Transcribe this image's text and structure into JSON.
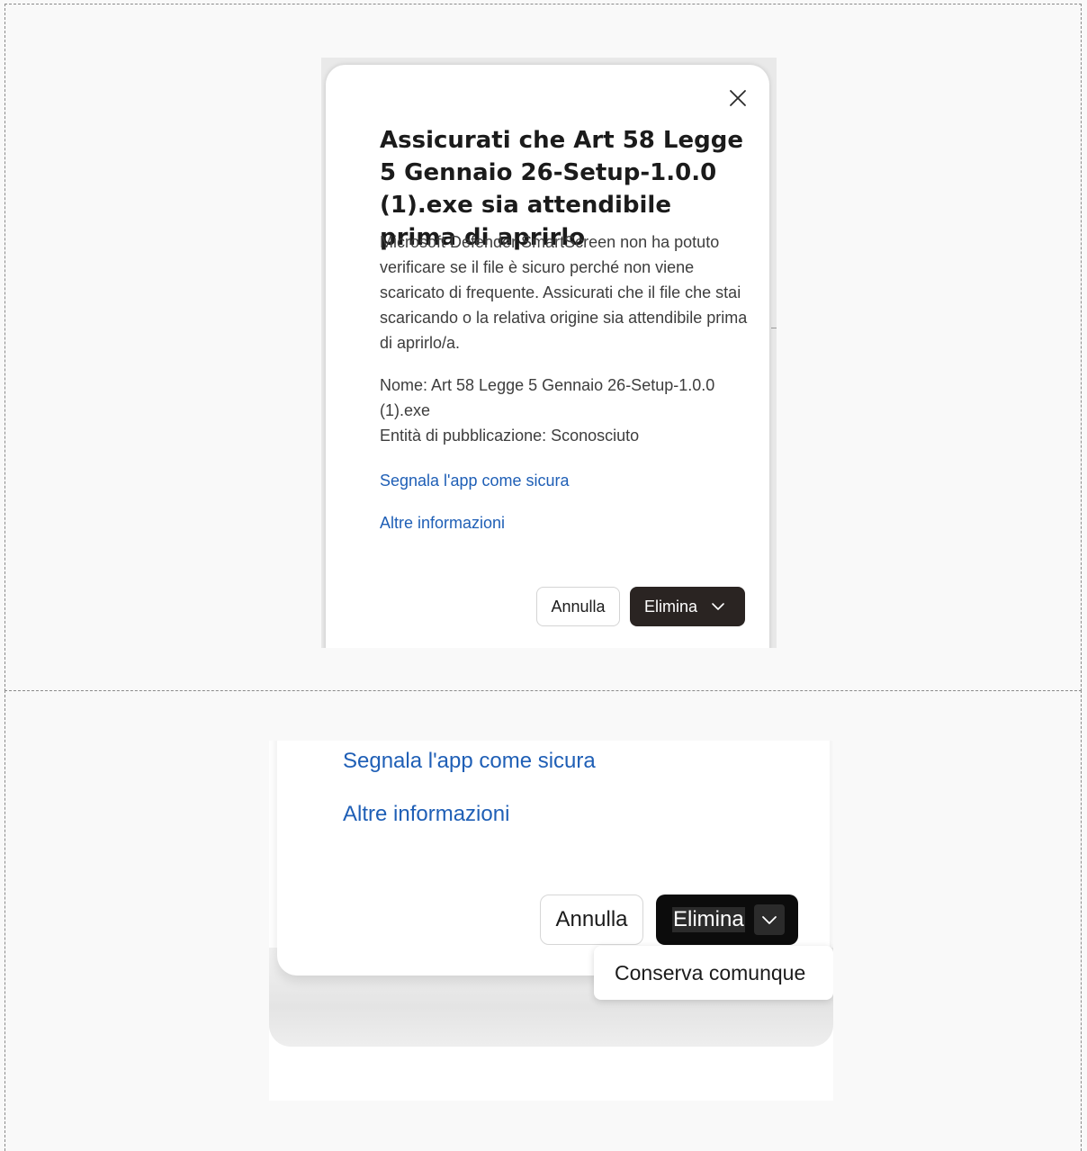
{
  "dialog": {
    "title": "Assicurati che Art 58 Legge 5 Gennaio 26-Setup-1.0.0 (1).exe sia attendibile prima di aprirlo",
    "body": "Microsoft Defender SmartScreen non ha potuto verificare se il file è sicuro perché non viene scaricato di frequente. Assicurati che il file che stai scaricando o la relativa origine sia attendibile prima di aprirlo/a.",
    "file_name": "Nome: Art 58 Legge 5 Gennaio 26-Setup-1.0.0 (1).exe",
    "publisher": "Entità di pubblicazione: Sconosciuto",
    "report_link": "Segnala l'app come sicura",
    "more_info_link": "Altre informazioni",
    "cancel_label": "Annulla",
    "delete_label": "Elimina",
    "close_icon": "close-icon",
    "chevron_icon": "chevron-down-icon"
  },
  "zoom": {
    "report_link": "Segnala l'app come sicura",
    "more_info_link": "Altre informazioni",
    "cancel_label": "Annulla",
    "delete_label": "Elimina",
    "menu_items": [
      "Conserva comunque"
    ]
  },
  "colors": {
    "link": "#1f5fb6",
    "primary_button": "#2a2422",
    "primary_button_zoom": "#0c0c0c"
  }
}
